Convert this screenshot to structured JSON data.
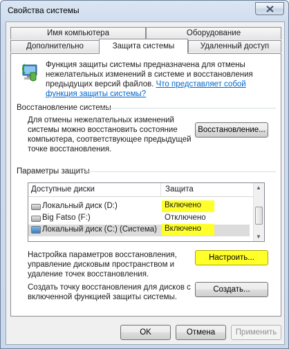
{
  "window": {
    "title": "Свойства системы"
  },
  "tabs": {
    "row1": [
      "Имя компьютера",
      "Оборудование"
    ],
    "row2": [
      "Дополнительно",
      "Защита системы",
      "Удаленный доступ"
    ]
  },
  "intro": {
    "line1": "Функция защиты системы предназначена для отмены",
    "line2": "нежелательных изменений в системе и восстановления",
    "line3": "предыдущих версий файлов.",
    "link_part1": "Что представляет собой",
    "link_part2": "функция защиты системы?"
  },
  "restore": {
    "group_title": "Восстановление системы",
    "line1": "Для отмены нежелательных изменений",
    "line2": "системы можно восстановить состояние",
    "line3": "компьютера, соответствующее предыдущей",
    "line4": "точке восстановления.",
    "button": "Восстановление..."
  },
  "protection": {
    "group_title": "Параметры защиты",
    "columns": [
      "Доступные диски",
      "Защита"
    ],
    "rows": [
      {
        "name": "Локальный диск (D:)",
        "status": "Включено",
        "icon": "drive-icon",
        "highlight": true
      },
      {
        "name": "Big Fatso (F:)",
        "status": "Отключено",
        "icon": "drive-icon",
        "highlight": false
      },
      {
        "name": "Локальный диск (C:) (Система)",
        "status": "Включено",
        "icon": "system-drive-icon",
        "highlight": true
      }
    ],
    "configure": {
      "line1": "Настройка параметров восстановления,",
      "line2": "управление дисковым пространством и",
      "line3": "удаление точек восстановления.",
      "button": "Настроить..."
    },
    "create": {
      "line1": "Создать точку восстановления для дисков с",
      "line2": "включенной функцией защиты системы.",
      "button": "Создать..."
    }
  },
  "footer": {
    "ok": "OK",
    "cancel": "Отмена",
    "apply": "Применить"
  },
  "colors": {
    "highlight": "#ffff2a",
    "link": "#0066cc"
  }
}
